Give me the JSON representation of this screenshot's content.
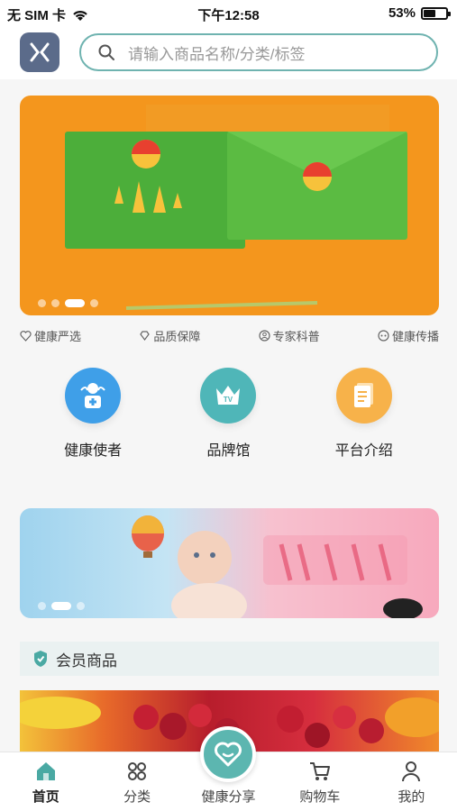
{
  "status_bar": {
    "carrier": "无 SIM 卡",
    "time": "下午12:58",
    "battery": "53%",
    "battery_level": 0.53
  },
  "header": {
    "logo_icon": "app-logo-icon",
    "search_placeholder": "请输入商品名称/分类/标签",
    "search_icon": "search-icon"
  },
  "banner": {
    "slide_count": 4,
    "active_slide": 2
  },
  "features": [
    {
      "label": "健康严选",
      "icon": "heart-shield-icon"
    },
    {
      "label": "品质保障",
      "icon": "diamond-icon"
    },
    {
      "label": "专家科普",
      "icon": "user-circle-icon"
    },
    {
      "label": "健康传播",
      "icon": "broadcast-icon"
    }
  ],
  "categories": [
    {
      "label": "健康使者",
      "icon": "nurse-icon",
      "color": "#3f9fe8"
    },
    {
      "label": "品牌馆",
      "icon": "crown-tv-icon",
      "color": "#4fb6b8"
    },
    {
      "label": "平台介绍",
      "icon": "document-icon",
      "color": "#f7b24a"
    }
  ],
  "banner2": {
    "slide_count": 3,
    "active_slide": 1
  },
  "member_section": {
    "title": "会员商品",
    "icon": "member-badge-icon"
  },
  "tabbar": {
    "tabs": [
      {
        "label": "首页",
        "icon": "home-icon",
        "active": true
      },
      {
        "label": "分类",
        "icon": "grid-icon",
        "active": false
      },
      {
        "label": "健康分享",
        "icon": "heart-icon",
        "active": false
      },
      {
        "label": "购物车",
        "icon": "cart-icon",
        "active": false
      },
      {
        "label": "我的",
        "icon": "user-icon",
        "active": false
      }
    ]
  },
  "colors": {
    "accent": "#5cb6b0",
    "banner_orange": "#f4961d",
    "search_border": "#6fb3b0"
  }
}
